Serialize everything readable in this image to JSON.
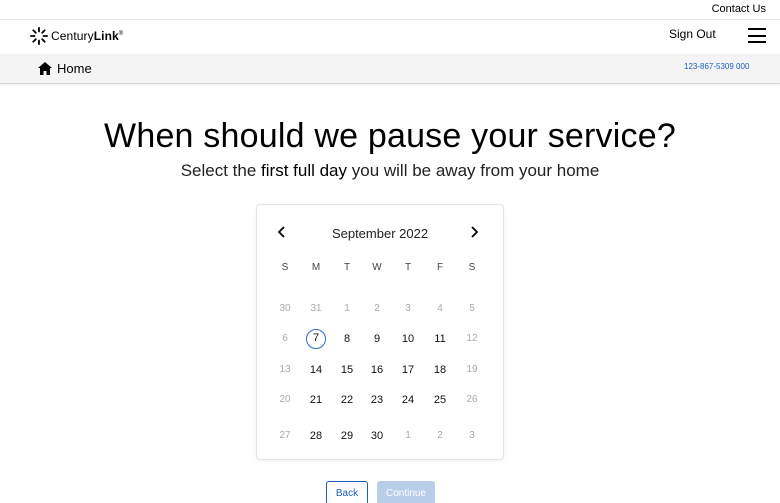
{
  "topbar": {
    "contact_label": "Contact Us"
  },
  "header": {
    "logo_text": "Century",
    "logo_text_bold": "Link",
    "logo_mark": "®",
    "signout_label": "Sign Out",
    "menu_icon": "hamburger-menu-icon"
  },
  "subnav": {
    "home_label": "Home",
    "home_icon": "home-icon",
    "phone": "123-867-5309 000"
  },
  "main": {
    "title": "When should we pause your service?",
    "subtitle_pre": "Select the ",
    "subtitle_strong": "first full day",
    "subtitle_post": " you will be away from your home"
  },
  "calendar": {
    "month_label": "September 2022",
    "prev_icon": "chevron-left-icon",
    "next_icon": "chevron-right-icon",
    "weekdays": [
      "S",
      "M",
      "T",
      "W",
      "T",
      "F",
      "S"
    ],
    "selected_day": "7",
    "weeks": [
      [
        {
          "d": "30",
          "muted": true
        },
        {
          "d": "31",
          "muted": true
        },
        {
          "d": "1",
          "muted": true
        },
        {
          "d": "2",
          "muted": true
        },
        {
          "d": "3",
          "muted": true
        },
        {
          "d": "4",
          "muted": true
        },
        {
          "d": "5",
          "muted": true
        }
      ],
      [
        {
          "d": "6",
          "muted": true
        },
        {
          "d": "7",
          "muted": false
        },
        {
          "d": "8",
          "muted": false
        },
        {
          "d": "9",
          "muted": false
        },
        {
          "d": "10",
          "muted": false
        },
        {
          "d": "11",
          "muted": false
        },
        {
          "d": "12",
          "muted": true
        }
      ],
      [
        {
          "d": "13",
          "muted": true
        },
        {
          "d": "14",
          "muted": false
        },
        {
          "d": "15",
          "muted": false
        },
        {
          "d": "16",
          "muted": false
        },
        {
          "d": "17",
          "muted": false
        },
        {
          "d": "18",
          "muted": false
        },
        {
          "d": "19",
          "muted": true
        }
      ],
      [
        {
          "d": "20",
          "muted": true
        },
        {
          "d": "21",
          "muted": false
        },
        {
          "d": "22",
          "muted": false
        },
        {
          "d": "23",
          "muted": false
        },
        {
          "d": "24",
          "muted": false
        },
        {
          "d": "25",
          "muted": false
        },
        {
          "d": "26",
          "muted": true
        }
      ],
      [
        {
          "d": "27",
          "muted": true
        },
        {
          "d": "28",
          "muted": false
        },
        {
          "d": "29",
          "muted": false
        },
        {
          "d": "30",
          "muted": false
        },
        {
          "d": "1",
          "muted": true
        },
        {
          "d": "2",
          "muted": true
        },
        {
          "d": "3",
          "muted": true
        }
      ]
    ]
  },
  "actions": {
    "back_label": "Back",
    "continue_label": "Continue"
  },
  "colors": {
    "accent": "#1d5fbf",
    "selected_ring": "#2a6ec9",
    "disabled_button": "#b8cdea"
  }
}
